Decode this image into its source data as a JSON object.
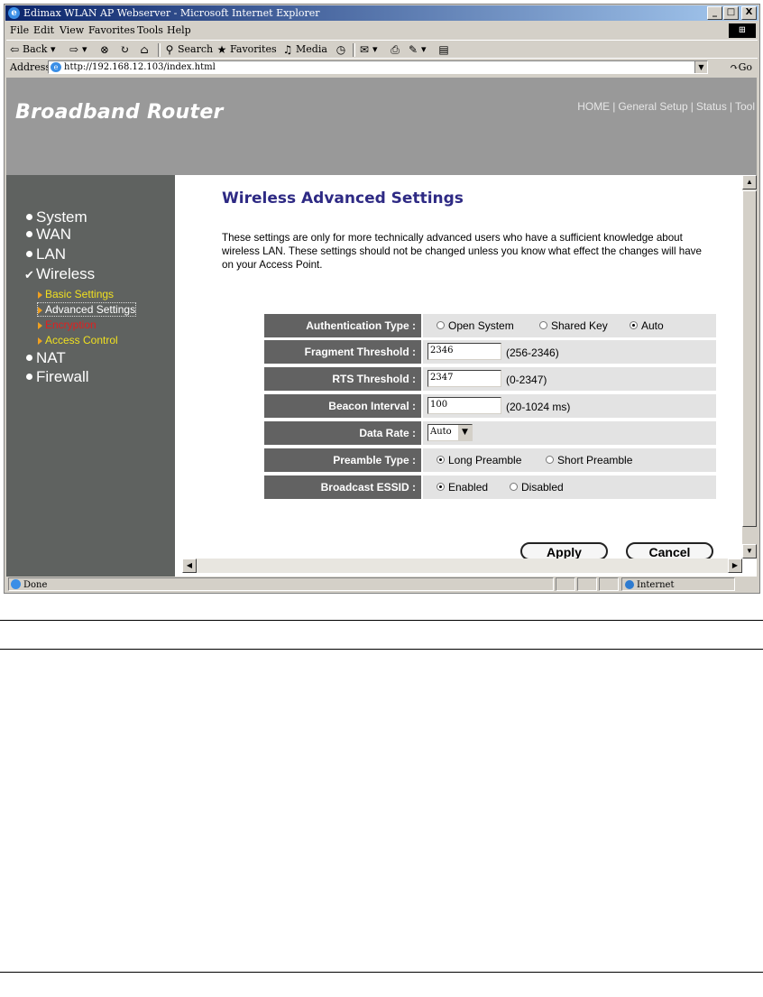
{
  "window": {
    "title": "Edimax WLAN AP Webserver - Microsoft Internet Explorer",
    "controls": [
      "_",
      "□",
      "X"
    ]
  },
  "menu": [
    "File",
    "Edit",
    "View",
    "Favorites",
    "Tools",
    "Help"
  ],
  "toolbar": {
    "back": "Back",
    "search": "Search",
    "favorites": "Favorites",
    "media": "Media"
  },
  "address": {
    "label": "Address",
    "url": "http://192.168.12.103/index.html",
    "go": "Go"
  },
  "router": {
    "brand": "Broadband Router",
    "topnav": [
      "HOME",
      "General Setup",
      "Status",
      "Tool"
    ],
    "sidebar": {
      "main": [
        "System",
        "WAN",
        "LAN",
        "Wireless",
        "NAT",
        "Firewall"
      ],
      "wireless_sub": [
        "Basic Settings",
        "Advanced Settings",
        "Encryption",
        "Access Control"
      ]
    },
    "heading": "Wireless Advanced Settings",
    "description": "These settings are only for more technically advanced users who have a sufficient knowledge about wireless LAN. These settings should not be changed unless you know what effect the changes will have on your Access Point.",
    "settings": {
      "auth": {
        "label": "Authentication Type :",
        "options": [
          "Open System",
          "Shared Key",
          "Auto"
        ],
        "selected": "Auto"
      },
      "fragment": {
        "label": "Fragment Threshold :",
        "value": "2346",
        "range": "(256-2346)"
      },
      "rts": {
        "label": "RTS Threshold :",
        "value": "2347",
        "range": "(0-2347)"
      },
      "beacon": {
        "label": "Beacon Interval :",
        "value": "100",
        "range": "(20-1024 ms)"
      },
      "data_rate": {
        "label": "Data Rate :",
        "value": "Auto"
      },
      "preamble": {
        "label": "Preamble Type :",
        "options": [
          "Long Preamble",
          "Short Preamble"
        ],
        "selected": "Long Preamble"
      },
      "essid": {
        "label": "Broadcast ESSID :",
        "options": [
          "Enabled",
          "Disabled"
        ],
        "selected": "Enabled"
      }
    },
    "buttons": {
      "apply": "Apply",
      "cancel": "Cancel"
    }
  },
  "status": {
    "text": "Done",
    "zone": "Internet"
  },
  "colors": {
    "banner": "#999999",
    "sidebar": "#5f6260",
    "heading": "#2e2a84",
    "sub_active": "#f0e020",
    "sub_selected": "#ffffff",
    "sub_encryption": "#e02020"
  }
}
